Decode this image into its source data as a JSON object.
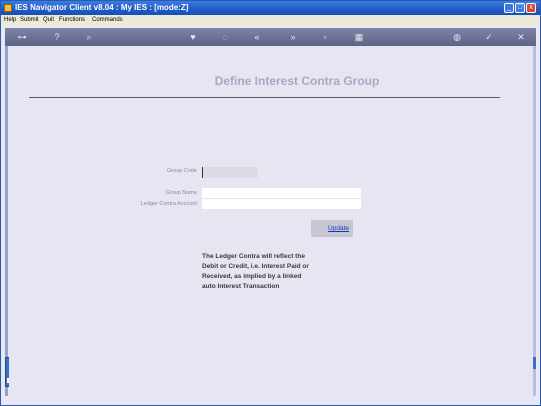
{
  "window": {
    "title": "IES Navigator Client v8.04 : My IES :      [mode:Z]",
    "minimize_glyph": "_",
    "maximize_glyph": "□",
    "close_glyph": "x"
  },
  "menu": [
    "Help",
    "Submit",
    "Quit",
    "Functions",
    "Commands"
  ],
  "toolbar": {
    "icons": [
      {
        "name": "key-icon",
        "glyph": "⊶"
      },
      {
        "name": "help-icon",
        "glyph": "?"
      },
      {
        "name": "search-icon",
        "glyph": "⌕"
      },
      {
        "name": "heart-icon",
        "glyph": "♥"
      },
      {
        "name": "history-icon",
        "glyph": "◌"
      },
      {
        "name": "back-icon",
        "glyph": "«"
      },
      {
        "name": "forward-icon",
        "glyph": "»"
      },
      {
        "name": "page-icon",
        "glyph": "▫"
      },
      {
        "name": "grid-icon",
        "glyph": "▦"
      },
      {
        "name": "globe-icon",
        "glyph": "◍"
      },
      {
        "name": "check-icon",
        "glyph": "✓"
      },
      {
        "name": "close-icon",
        "glyph": "✕"
      }
    ]
  },
  "page": {
    "title": "Define Interest Contra Group"
  },
  "form": {
    "group_code_label": "Group Code",
    "group_code_value": "",
    "group_name_label": "Group Name",
    "group_name_value": "",
    "ledger_contra_label": "Ledger Contra Account",
    "ledger_contra_value": "",
    "update_label": "Update"
  },
  "note": [
    "The Ledger Contra will reflect the",
    "Debit or Credit, i.e. Interest Paid or",
    "Received, as implied by a linked",
    "auto Interest Transaction"
  ]
}
